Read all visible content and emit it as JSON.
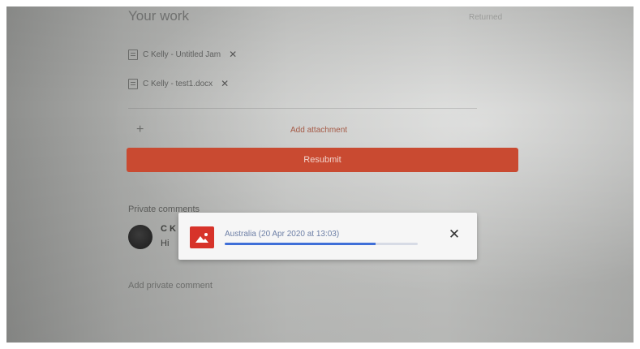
{
  "your_work": {
    "title": "Your work",
    "status": "Returned"
  },
  "attachments": [
    {
      "name": "C Kelly - Untitled Jam"
    },
    {
      "name": "C Kelly - test1.docx"
    }
  ],
  "add_attachment": {
    "label": "Add attachment"
  },
  "resubmit": {
    "label": "Resubmit"
  },
  "private_comments": {
    "title": "Private comments",
    "comment": {
      "author": "C K",
      "text": "Hi"
    },
    "add_label": "Add private comment"
  },
  "upload_toast": {
    "file_name": "Australia (20 Apr 2020 at 13:03)",
    "progress": 0.78
  },
  "colors": {
    "accent": "#c94a31",
    "progress": "#3f6fd8",
    "image_icon": "#d7332a"
  }
}
